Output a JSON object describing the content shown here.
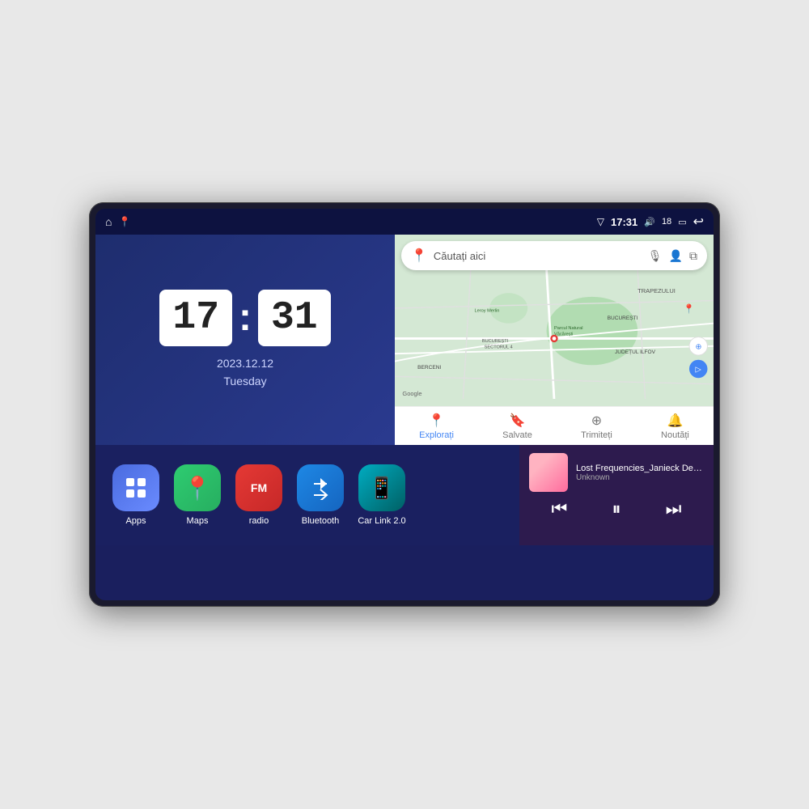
{
  "device": {
    "screen_bg": "#1a1f5e"
  },
  "status_bar": {
    "signal_icon": "▽",
    "time": "17:31",
    "volume_icon": "🔊",
    "battery_num": "18",
    "battery_icon": "▭",
    "back_icon": "↩"
  },
  "status_left": {
    "home_icon": "⌂",
    "maps_pin_icon": "📍"
  },
  "clock": {
    "hour": "17",
    "minute": "31",
    "date": "2023.12.12",
    "day": "Tuesday"
  },
  "map": {
    "search_placeholder": "Căutați aici",
    "nav_items": [
      {
        "label": "Explorați",
        "icon": "📍"
      },
      {
        "label": "Salvate",
        "icon": "🔖"
      },
      {
        "label": "Trimiteți",
        "icon": "⊕"
      },
      {
        "label": "Noutăți",
        "icon": "🔔"
      }
    ],
    "labels": [
      "TRAPEZULUI",
      "BUCUREȘTI",
      "JUDEȚUL ILFOV",
      "BERCENI",
      "Leroy Merlin",
      "Parcul Natural Văcărești",
      "BUCUREȘTI\nSECTORUL 4"
    ],
    "google_label": "Google"
  },
  "apps": [
    {
      "label": "Apps",
      "icon": "⊞",
      "bg": "#4a6bdf"
    },
    {
      "label": "Maps",
      "icon": "📍",
      "bg": "#34a853"
    },
    {
      "label": "radio",
      "icon": "FM",
      "bg": "#e53935"
    },
    {
      "label": "Bluetooth",
      "icon": "ᛒ",
      "bg": "#2979ff"
    },
    {
      "label": "Car Link 2.0",
      "icon": "📱",
      "bg": "#00acc1"
    }
  ],
  "music": {
    "title": "Lost Frequencies_Janieck Devy-...",
    "artist": "Unknown",
    "prev_icon": "⏮",
    "play_icon": "⏸",
    "next_icon": "⏭"
  }
}
